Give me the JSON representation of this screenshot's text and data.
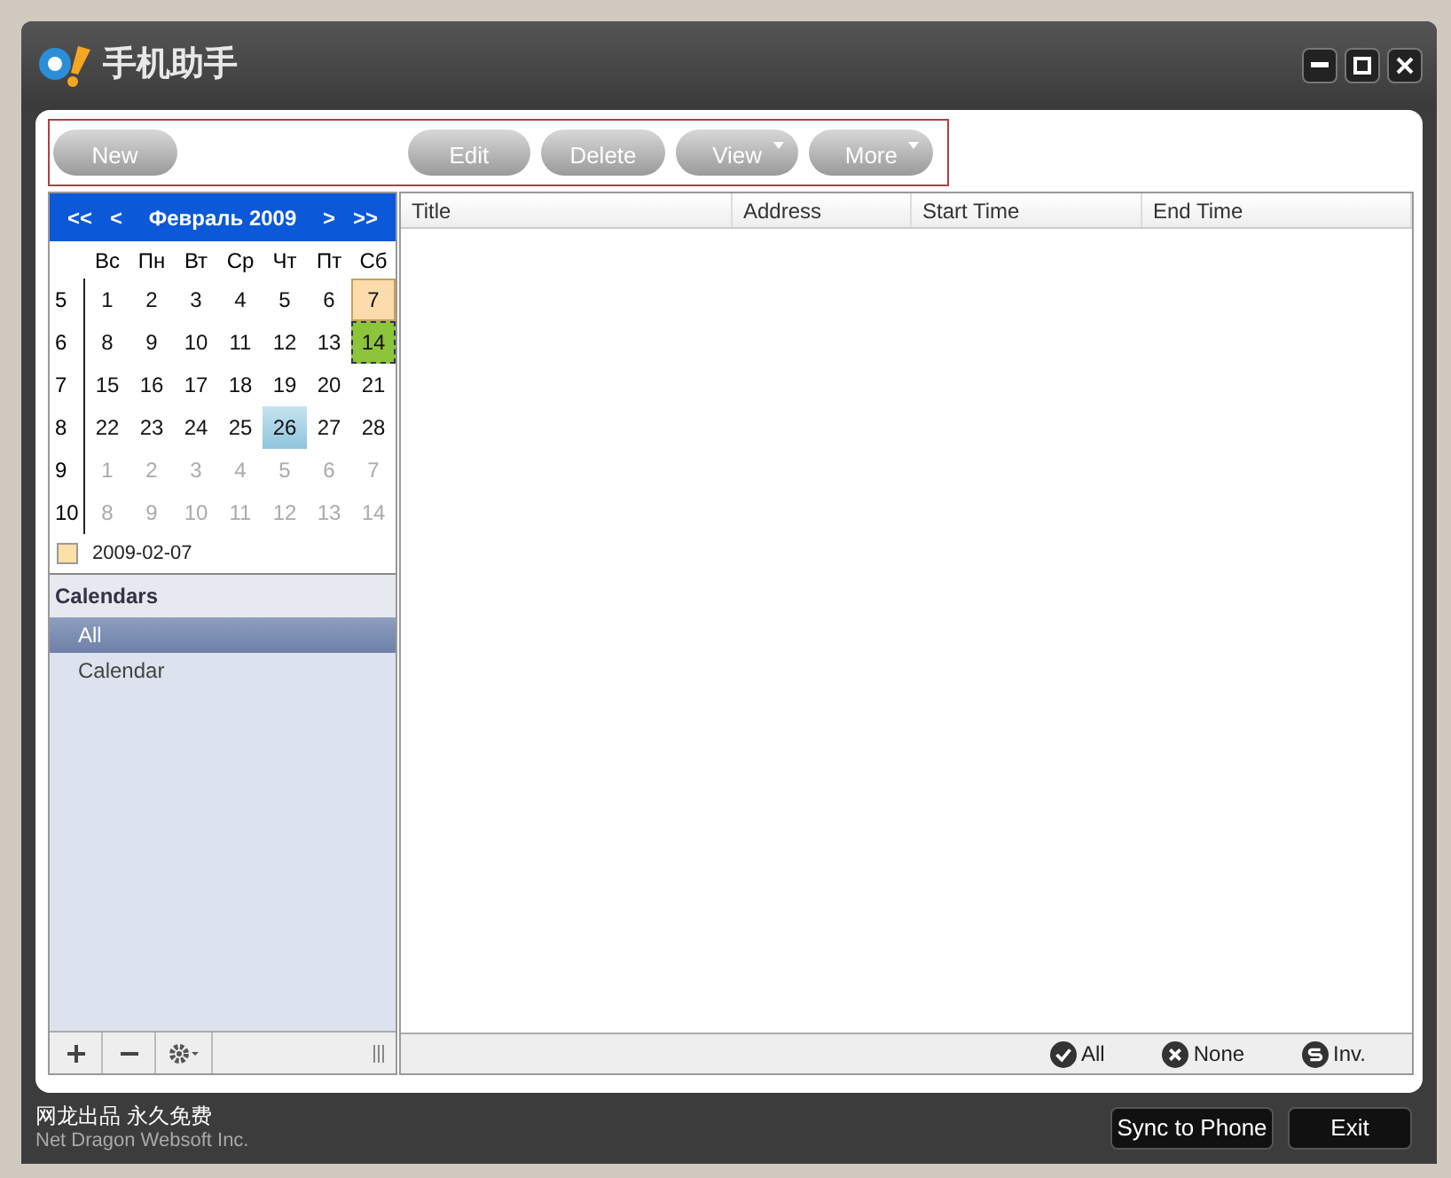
{
  "window": {
    "title": "手机助手"
  },
  "toolbar": [
    {
      "label": "New",
      "dropdown": false
    },
    {
      "label": "Edit",
      "dropdown": false
    },
    {
      "label": "Delete",
      "dropdown": false
    },
    {
      "label": "View",
      "dropdown": true
    },
    {
      "label": "More",
      "dropdown": true
    }
  ],
  "calendar": {
    "nav": [
      "<<",
      "<"
    ],
    "nav_right": [
      ">",
      ">>"
    ],
    "month": "Февраль 2009",
    "weekdays": [
      "Вс",
      "Пн",
      "Вт",
      "Ср",
      "Чт",
      "Пт",
      "Сб"
    ],
    "weeks": [
      {
        "number": "5",
        "days": [
          {
            "day": "1",
            "other_month": false,
            "selected": false,
            "marked": false,
            "today": false
          },
          {
            "day": "2",
            "other_month": false,
            "selected": false,
            "marked": false,
            "today": false
          },
          {
            "day": "3",
            "other_month": false,
            "selected": false,
            "marked": false,
            "today": false
          },
          {
            "day": "4",
            "other_month": false,
            "selected": false,
            "marked": false,
            "today": false
          },
          {
            "day": "5",
            "other_month": false,
            "selected": false,
            "marked": false,
            "today": false
          },
          {
            "day": "6",
            "other_month": false,
            "selected": false,
            "marked": false,
            "today": false
          },
          {
            "day": "7",
            "other_month": false,
            "selected": false,
            "marked": true,
            "today": false
          }
        ]
      },
      {
        "number": "6",
        "days": [
          {
            "day": "8",
            "other_month": false,
            "selected": false,
            "marked": false,
            "today": false
          },
          {
            "day": "9",
            "other_month": false,
            "selected": false,
            "marked": false,
            "today": false
          },
          {
            "day": "10",
            "other_month": false,
            "selected": false,
            "marked": false,
            "today": false
          },
          {
            "day": "11",
            "other_month": false,
            "selected": false,
            "marked": false,
            "today": false
          },
          {
            "day": "12",
            "other_month": false,
            "selected": false,
            "marked": false,
            "today": false
          },
          {
            "day": "13",
            "other_month": false,
            "selected": false,
            "marked": false,
            "today": false
          },
          {
            "day": "14",
            "other_month": false,
            "selected": true,
            "marked": false,
            "today": false
          }
        ]
      },
      {
        "number": "7",
        "days": [
          {
            "day": "15",
            "other_month": false,
            "selected": false,
            "marked": false,
            "today": false
          },
          {
            "day": "16",
            "other_month": false,
            "selected": false,
            "marked": false,
            "today": false
          },
          {
            "day": "17",
            "other_month": false,
            "selected": false,
            "marked": false,
            "today": false
          },
          {
            "day": "18",
            "other_month": false,
            "selected": false,
            "marked": false,
            "today": false
          },
          {
            "day": "19",
            "other_month": false,
            "selected": false,
            "marked": false,
            "today": false
          },
          {
            "day": "20",
            "other_month": false,
            "selected": false,
            "marked": false,
            "today": false
          },
          {
            "day": "21",
            "other_month": false,
            "selected": false,
            "marked": false,
            "today": false
          }
        ]
      },
      {
        "number": "8",
        "days": [
          {
            "day": "22",
            "other_month": false,
            "selected": false,
            "marked": false,
            "today": false
          },
          {
            "day": "23",
            "other_month": false,
            "selected": false,
            "marked": false,
            "today": false
          },
          {
            "day": "24",
            "other_month": false,
            "selected": false,
            "marked": false,
            "today": false
          },
          {
            "day": "25",
            "other_month": false,
            "selected": false,
            "marked": false,
            "today": false
          },
          {
            "day": "26",
            "other_month": false,
            "selected": false,
            "marked": false,
            "today": true
          },
          {
            "day": "27",
            "other_month": false,
            "selected": false,
            "marked": false,
            "today": false
          },
          {
            "day": "28",
            "other_month": false,
            "selected": false,
            "marked": false,
            "today": false
          }
        ]
      },
      {
        "number": "9",
        "days": [
          {
            "day": "1",
            "other_month": true,
            "selected": false,
            "marked": false,
            "today": false
          },
          {
            "day": "2",
            "other_month": true,
            "selected": false,
            "marked": false,
            "today": false
          },
          {
            "day": "3",
            "other_month": true,
            "selected": false,
            "marked": false,
            "today": false
          },
          {
            "day": "4",
            "other_month": true,
            "selected": false,
            "marked": false,
            "today": false
          },
          {
            "day": "5",
            "other_month": true,
            "selected": false,
            "marked": false,
            "today": false
          },
          {
            "day": "6",
            "other_month": true,
            "selected": false,
            "marked": false,
            "today": false
          },
          {
            "day": "7",
            "other_month": true,
            "selected": false,
            "marked": false,
            "today": false
          }
        ]
      },
      {
        "number": "10",
        "days": [
          {
            "day": "8",
            "other_month": true,
            "selected": false,
            "marked": false,
            "today": false
          },
          {
            "day": "9",
            "other_month": true,
            "selected": false,
            "marked": false,
            "today": false
          },
          {
            "day": "10",
            "other_month": true,
            "selected": false,
            "marked": false,
            "today": false
          },
          {
            "day": "11",
            "other_month": true,
            "selected": false,
            "marked": false,
            "today": false
          },
          {
            "day": "12",
            "other_month": true,
            "selected": false,
            "marked": false,
            "today": false
          },
          {
            "day": "13",
            "other_month": true,
            "selected": false,
            "marked": false,
            "today": false
          },
          {
            "day": "14",
            "other_month": true,
            "selected": false,
            "marked": false,
            "today": false
          }
        ]
      }
    ],
    "legend": "2009-02-07"
  },
  "calendars": {
    "heading": "Calendars",
    "items": [
      {
        "label": "All",
        "selected": true
      },
      {
        "label": "Calendar",
        "selected": false
      }
    ]
  },
  "table": {
    "columns": [
      "Title",
      "Address",
      "Start Time",
      "End Time"
    ]
  },
  "filters": [
    {
      "kind": "check",
      "label": "All"
    },
    {
      "kind": "cross",
      "label": "None"
    },
    {
      "kind": "invert",
      "label": "Inv."
    }
  ],
  "footer": {
    "line1": "网龙出品 永久免费",
    "line2": "Net Dragon Websoft Inc.",
    "buttons": [
      "Sync to Phone",
      "Exit"
    ]
  }
}
